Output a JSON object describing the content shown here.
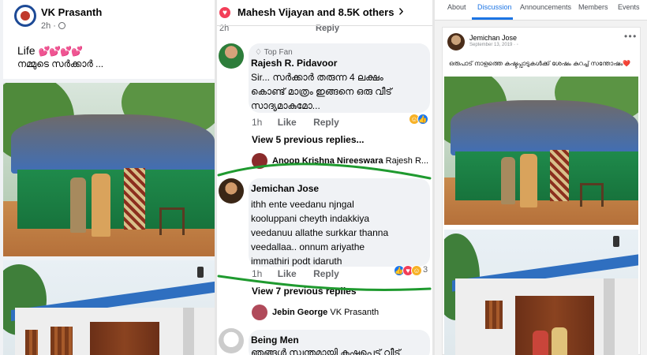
{
  "left_post": {
    "author": "VK Prasanth",
    "time": "2h",
    "text_line1": "Life",
    "text_line1_emoji": "💕💕💕💕",
    "text_line2": "നമ്മുടെ സർക്കാർ ..."
  },
  "comments_panel": {
    "reactions_header": "Mahesh Vijayan and 8.5K others",
    "faded_reply_time": "2h",
    "faded_reply_label": "Reply",
    "top_comment": {
      "badge": "Top Fan",
      "author": "Rajesh R. Pidavoor",
      "text": "Sir... സർക്കാർ തരുന്ന 4 ലക്ഷം കൊണ്ട് മാത്രം ഇങ്ങനെ ഒരു വീട് സാദ്യമാകുമോ...",
      "time": "1h",
      "like": "Like",
      "reply": "Reply"
    },
    "view_prev_1": "View 5 previous replies...",
    "reply_1": {
      "author": "Anoop Krishna Nireeswara",
      "tag": "Rajesh R..."
    },
    "main_comment": {
      "author": "Jemichan Jose",
      "lines": [
        "ithh   ente   veedanu njngal",
        "kooluppani  cheyth  indakkiya",
        "veedanuu  allathe  surkkar thanna",
        "veedallaa.. onnum  ariyathe",
        "immathiri podt  idaruth"
      ],
      "time": "1h",
      "like": "Like",
      "reply": "Reply",
      "reaction_count": "3"
    },
    "view_prev_2": "View 7 previous replies",
    "reply_2": {
      "author": "Jebin George",
      "tag": "VK Prasanth"
    },
    "next_comment": {
      "author": "Being Men",
      "text": "ഞങ്ങൾ സ്വന്തമായി കഷ്ടപ്പെട്ട് വീട്"
    }
  },
  "group_panel": {
    "tabs": [
      "About",
      "Discussion",
      "Announcements",
      "Members",
      "Events"
    ],
    "active_tab": "Discussion",
    "post": {
      "author": "Jemichan Jose",
      "date": "September 13, 2019",
      "text": "ഒരുപാട് നാളത്തെ കഷ്ടപ്പാടുകൾക്ക് ശേഷം കുറച്ച് സന്തോഷം❤️"
    }
  },
  "colors": {
    "fb_blue": "#1b74e4",
    "like_blue": "#1877f2",
    "love_red": "#f33e58",
    "annotation_green": "#1f9a2f"
  }
}
